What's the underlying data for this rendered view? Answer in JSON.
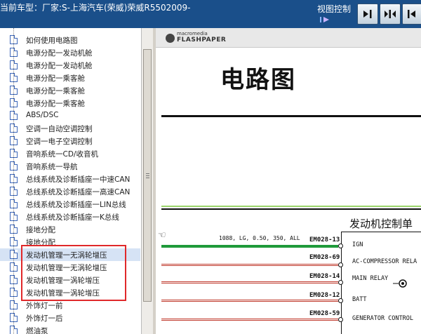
{
  "header": {
    "vehicle_text": "当前车型：厂家:S-上海汽车(荣威)荣威R5502009-",
    "view_control_label": "视图控制",
    "buttons": [
      "show-panel-button",
      "split-view-button",
      "hide-panel-button"
    ]
  },
  "tree": {
    "items": [
      {
        "label": "如何使用电路图"
      },
      {
        "label": "电源分配一发动机舱"
      },
      {
        "label": "电源分配一发动机舱"
      },
      {
        "label": "电源分配一乘客舱"
      },
      {
        "label": "电源分配一乘客舱"
      },
      {
        "label": "电源分配一乘客舱"
      },
      {
        "label": "ABS/DSC"
      },
      {
        "label": "空调一自动空调控制"
      },
      {
        "label": "空调一电子空调控制"
      },
      {
        "label": "音响系统一CD/收音机"
      },
      {
        "label": "音响系统一导航"
      },
      {
        "label": "总线系统及诊断插座一中速CAN"
      },
      {
        "label": "总线系统及诊断插座一高速CAN"
      },
      {
        "label": "总线系统及诊断插座一LIN总线"
      },
      {
        "label": "总线系统及诊断插座一K总线"
      },
      {
        "label": "接地分配"
      },
      {
        "label": "接地分配"
      },
      {
        "label": "发动机管理一无涡轮增压"
      },
      {
        "label": "发动机管理一无涡轮增压"
      },
      {
        "label": "发动机管理一涡轮增压"
      },
      {
        "label": "发动机管理一涡轮增压"
      },
      {
        "label": "外饰灯一前"
      },
      {
        "label": "外饰灯一后"
      },
      {
        "label": "燃油泵"
      }
    ]
  },
  "viewer": {
    "brand_small": "macromedia",
    "brand_name": "FLASHPAPER",
    "page_title": "电路图",
    "section_title": "发动机控制单",
    "wire_label": "1088, LG, 0.50, 350, ALL",
    "connectors": [
      {
        "pin": "EM028-13",
        "signal": "IGN",
        "color": "#1f9a3a"
      },
      {
        "pin": "EM028-69",
        "signal": "AC-COMPRESSOR RELA",
        "color": "#c0392b"
      },
      {
        "pin": "EM028-14",
        "signal": "MAIN RELAY",
        "color": "#c0392b"
      },
      {
        "pin": "EM028-12",
        "signal": "BATT",
        "color": "#c0392b"
      },
      {
        "pin": "EM028-59",
        "signal": "GENERATOR CONTROL",
        "color": "#c0392b"
      }
    ]
  },
  "colors": {
    "header_bg": "#1a4f8a",
    "highlight_border": "#e0282a",
    "green_rail": "#1f9a3a"
  }
}
